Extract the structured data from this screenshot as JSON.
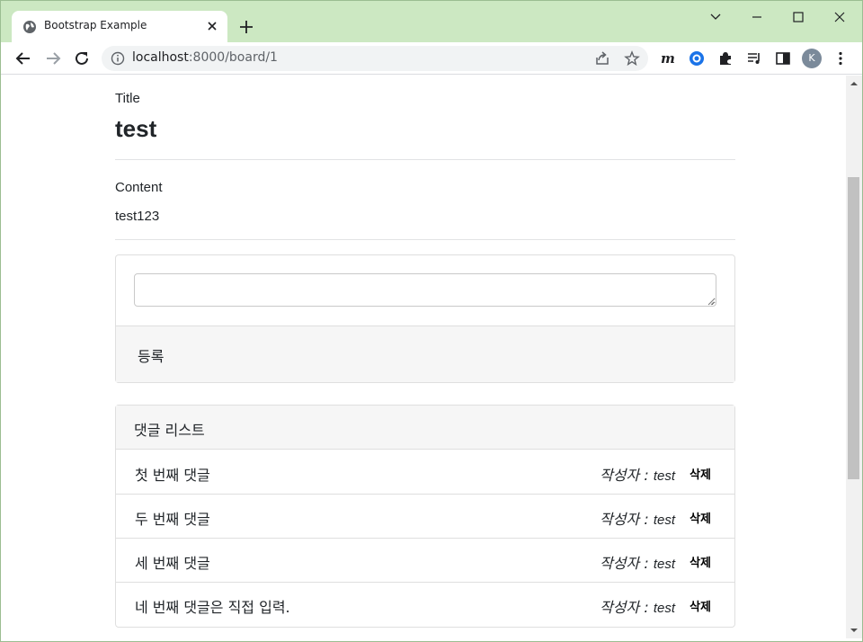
{
  "browser": {
    "tab_title": "Bootstrap Example",
    "url_host": "localhost",
    "url_rest": ":8000/board/1",
    "avatar_letter": "K"
  },
  "post": {
    "title_label": "Title",
    "title": "test",
    "content_label": "Content",
    "content": "test123"
  },
  "comment_form": {
    "textarea_value": "",
    "submit_label": "등록"
  },
  "comment_list": {
    "header": "댓글 리스트",
    "author_prefix": "작성자 : ",
    "delete_label": "삭제",
    "items": [
      {
        "text": "첫 번째 댓글",
        "author": "test"
      },
      {
        "text": "두 번째 댓글",
        "author": "test"
      },
      {
        "text": "세 번째 댓글",
        "author": "test"
      },
      {
        "text": "네 번째 댓글은 직접 입력.",
        "author": "test"
      }
    ]
  }
}
